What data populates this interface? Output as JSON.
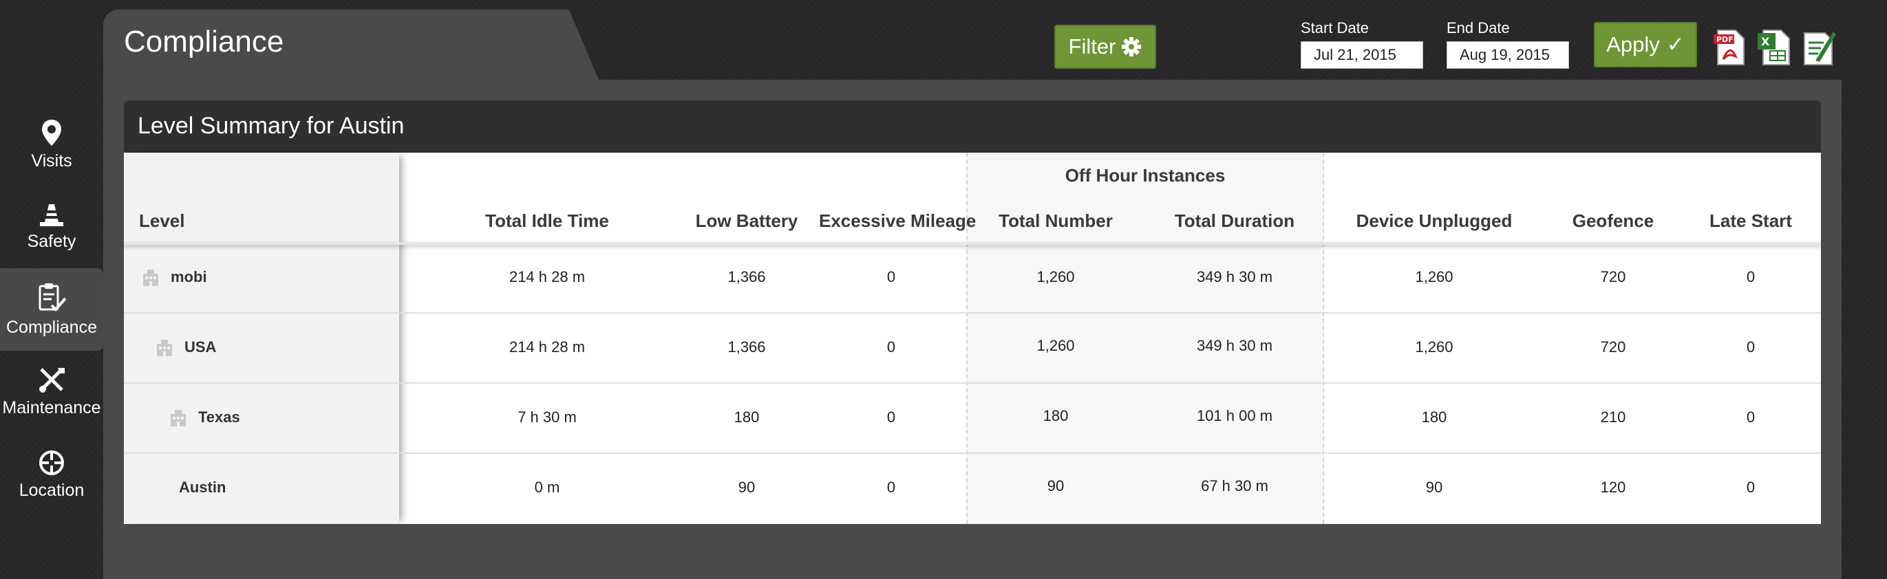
{
  "page": {
    "title": "Compliance"
  },
  "sidebar": {
    "items": [
      {
        "label": "Visits",
        "icon": "map-pin-icon",
        "active": false
      },
      {
        "label": "Safety",
        "icon": "traffic-cone-icon",
        "active": false
      },
      {
        "label": "Compliance",
        "icon": "clipboard-check-icon",
        "active": true
      },
      {
        "label": "Maintenance",
        "icon": "tools-icon",
        "active": false
      },
      {
        "label": "Location",
        "icon": "crosshair-icon",
        "active": false
      }
    ]
  },
  "toolbar": {
    "filter_label": "Filter",
    "start_date_label": "Start Date",
    "start_date_value": "Jul 21, 2015",
    "end_date_label": "End Date",
    "end_date_value": "Aug 19, 2015",
    "apply_label": "Apply",
    "exports": [
      "pdf-export-icon",
      "excel-export-icon",
      "edit-export-icon"
    ]
  },
  "table": {
    "title": "Level Summary for Austin",
    "group_header": "Off Hour Instances",
    "columns": [
      "Level",
      "Total Idle Time",
      "Low Battery",
      "Excessive Mileage",
      "Total Number",
      "Total Duration",
      "Device Unplugged",
      "Geofence",
      "Late Start"
    ],
    "rows": [
      {
        "level": "mobi",
        "icon": "building-icon",
        "cells": [
          "214 h 28 m",
          "1,366",
          "0",
          "1,260",
          "349 h 30 m",
          "1,260",
          "720",
          "0"
        ]
      },
      {
        "level": "USA",
        "icon": "building-icon",
        "cells": [
          "214 h 28 m",
          "1,366",
          "0",
          "1,260",
          "349 h 30 m",
          "1,260",
          "720",
          "0"
        ]
      },
      {
        "level": "Texas",
        "icon": "building-icon",
        "cells": [
          "7 h 30 m",
          "180",
          "0",
          "180",
          "101 h 00 m",
          "180",
          "210",
          "0"
        ]
      },
      {
        "level": "Austin",
        "icon": "",
        "cells": [
          "0 m",
          "90",
          "0",
          "90",
          "67 h 30 m",
          "90",
          "120",
          "0"
        ]
      }
    ]
  },
  "colors": {
    "accent_green": "#6f9636",
    "header_dark": "#2f2f30",
    "panel": "#4b4a4b"
  }
}
